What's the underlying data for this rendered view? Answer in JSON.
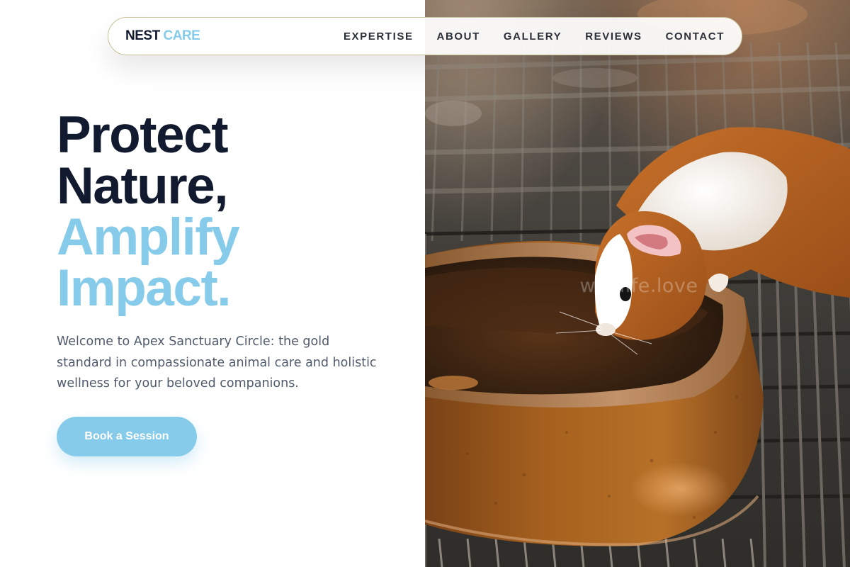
{
  "brand": {
    "part1": "NEST",
    "part2": "CARE"
  },
  "nav": {
    "items": [
      {
        "label": "EXPERTISE"
      },
      {
        "label": "ABOUT"
      },
      {
        "label": "GALLERY"
      },
      {
        "label": "REVIEWS"
      },
      {
        "label": "CONTACT"
      }
    ]
  },
  "hero": {
    "line1": "Protect",
    "line2": "Nature,",
    "line3": "Amplify",
    "line4": "Impact.",
    "lead": "Welcome to Apex Sanctuary Circle: the gold standard in compassionate animal care and holistic wellness for your beloved companions.",
    "cta_label": "Book a Session"
  },
  "image": {
    "watermark": "wildlife.love",
    "subject": "guinea pig drinking from a clay water bowl on a wire cage floor"
  },
  "colors": {
    "accent": "#86cbea",
    "heading": "#111a2e",
    "body_text": "#4f5a6b",
    "nav_border": "#c8c29a"
  }
}
